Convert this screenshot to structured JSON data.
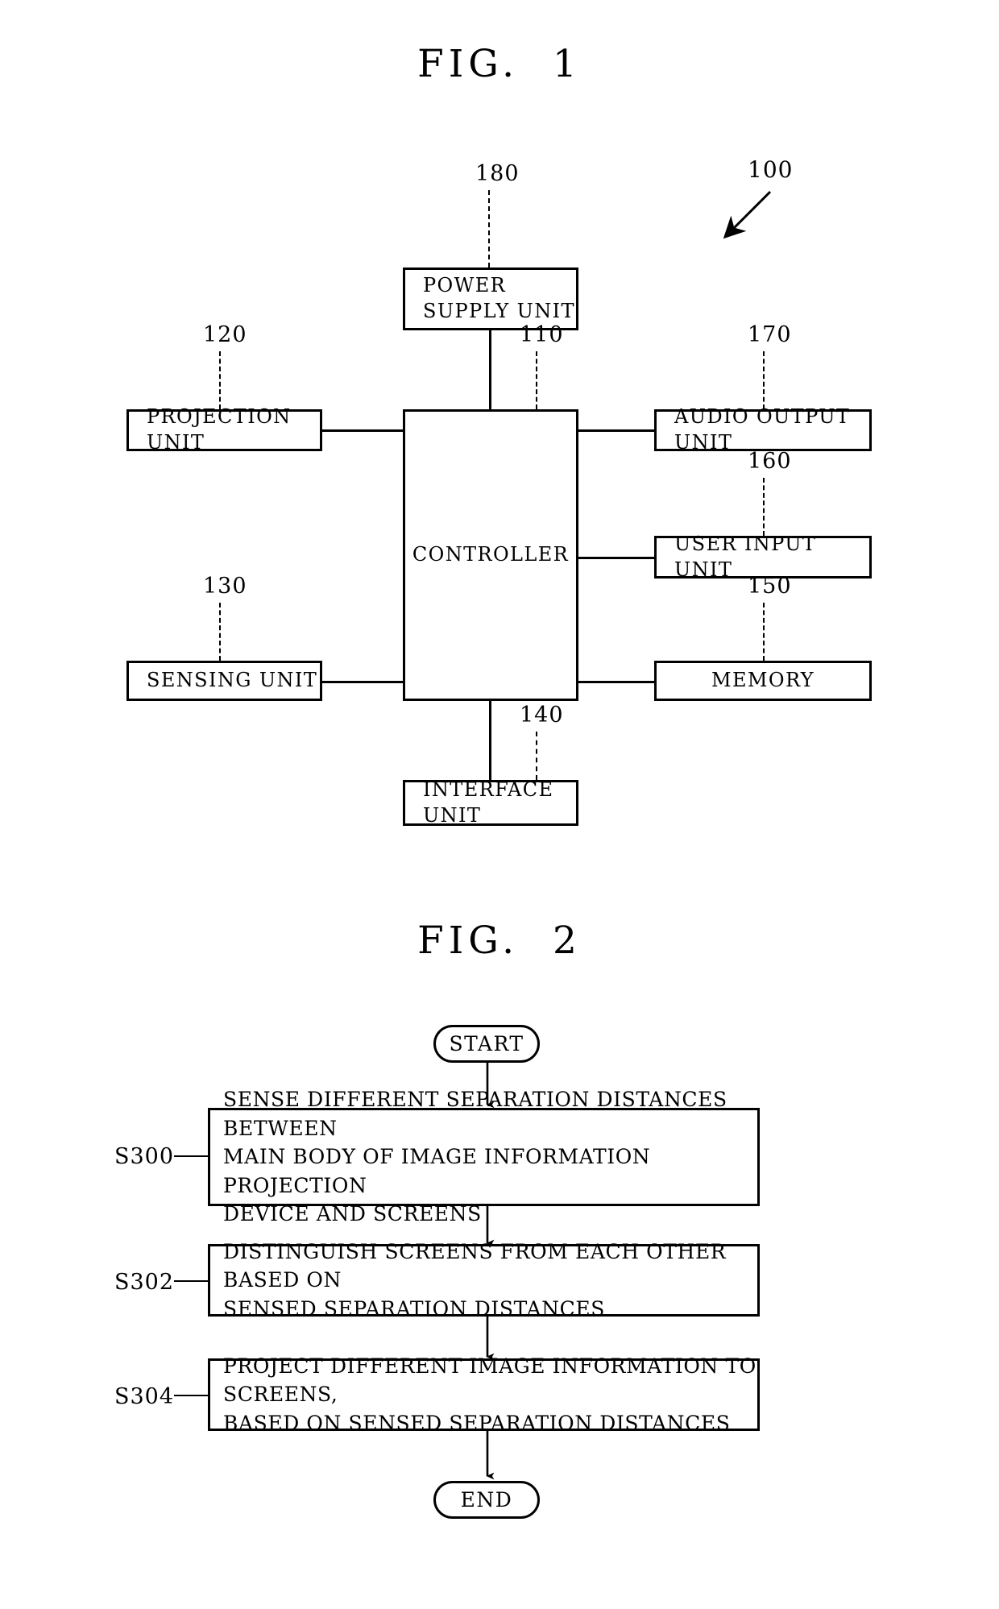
{
  "figures": [
    {
      "title": "FIG.  1",
      "type": "block-diagram",
      "device_ref": "100",
      "blocks": [
        {
          "ref": "180",
          "label": "POWER\nSUPPLY UNIT"
        },
        {
          "ref": "120",
          "label": "PROJECTION UNIT"
        },
        {
          "ref": "110",
          "label": "CONTROLLER"
        },
        {
          "ref": "170",
          "label": "AUDIO OUTPUT UNIT"
        },
        {
          "ref": "160",
          "label": "USER INPUT UNIT"
        },
        {
          "ref": "130",
          "label": "SENSING UNIT"
        },
        {
          "ref": "150",
          "label": "MEMORY"
        },
        {
          "ref": "140",
          "label": "INTERFACE UNIT"
        }
      ]
    },
    {
      "title": "FIG.  2",
      "type": "flowchart",
      "start_label": "START",
      "end_label": "END",
      "steps": [
        {
          "ref": "S300",
          "text": "SENSE DIFFERENT SEPARATION DISTANCES BETWEEN\nMAIN BODY OF IMAGE INFORMATION PROJECTION\nDEVICE AND SCREENS"
        },
        {
          "ref": "S302",
          "text": "DISTINGUISH SCREENS FROM EACH OTHER BASED ON\nSENSED SEPARATION DISTANCES"
        },
        {
          "ref": "S304",
          "text": "PROJECT DIFFERENT IMAGE INFORMATION TO SCREENS,\nBASED ON SENSED SEPARATION DISTANCES"
        }
      ]
    }
  ],
  "colors": {
    "ink": "#000000",
    "paper": "#ffffff"
  }
}
